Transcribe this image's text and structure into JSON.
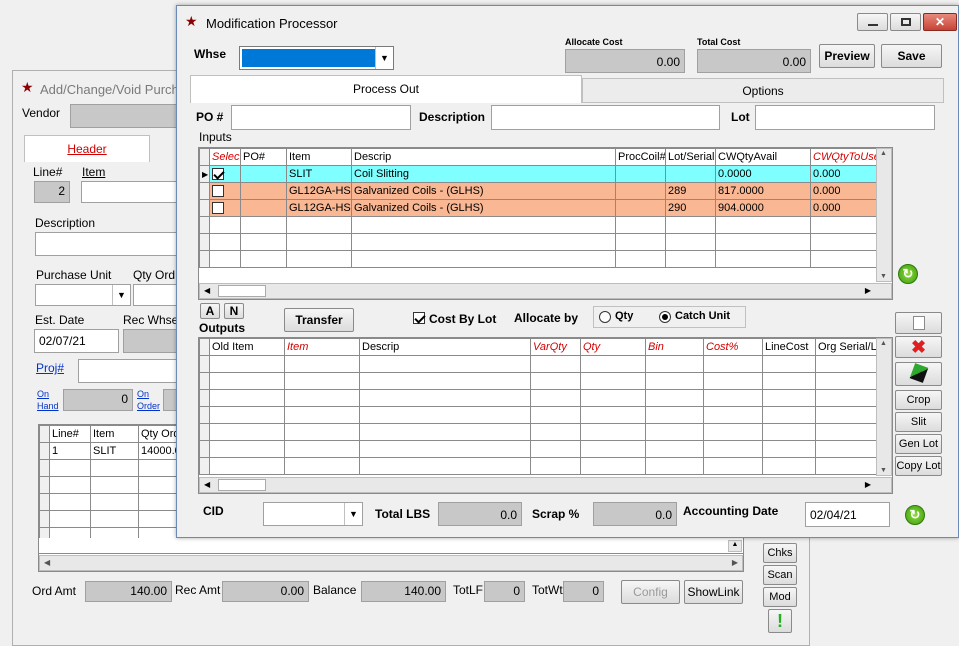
{
  "bg_window": {
    "title": "Add/Change/Void Purcha",
    "vendor_label": "Vendor",
    "header_tab": "Header",
    "line_label": "Line#",
    "line_value": "2",
    "item_label": "Item",
    "description_label": "Description",
    "purchase_unit_label": "Purchase Unit",
    "qty_ord_label": "Qty Ord",
    "est_date_label": "Est. Date",
    "est_date_value": "02/07/21",
    "rec_whse_label": "Rec Whse",
    "proj_label": "Proj#",
    "on_hand_label_1": "On",
    "on_hand_label_2": "Hand",
    "on_hand_value": "0",
    "on_order_label_1": "On",
    "on_order_label_2": "Order",
    "grid_headers": [
      "Line#",
      "Item",
      "Qty Ord"
    ],
    "grid_rows": [
      {
        "line": "1",
        "item": "SLIT",
        "qty": "14000.0"
      }
    ],
    "ord_amt_label": "Ord Amt",
    "ord_amt_value": "140.00",
    "rec_amt_label": "Rec Amt",
    "rec_amt_value": "0.00",
    "balance_label": "Balance",
    "balance_value": "140.00",
    "totlf_label": "TotLF",
    "totlf_value": "0",
    "totwt_label": "TotWt",
    "totwt_value": "0",
    "config_button": "Config",
    "showlink_button": "ShowLink",
    "chks_button": "Chks",
    "scan_button": "Scan",
    "mod_button": "Mod",
    "alert_glyph": "!"
  },
  "mod_window": {
    "title": "Modification Processor",
    "whse_label": "Whse",
    "allocate_cost_label": "Allocate Cost",
    "allocate_cost_value": "0.00",
    "total_cost_label": "Total Cost",
    "total_cost_value": "0.00",
    "preview_button": "Preview",
    "save_button": "Save",
    "tabs": [
      "Process Out",
      "Options"
    ],
    "po_label": "PO #",
    "description_label": "Description",
    "lot_label": "Lot",
    "inputs_label": "Inputs",
    "inputs_headers": [
      "Select",
      "PO#",
      "Item",
      "Descrip",
      "ProcCoil#",
      "Lot/Serial",
      "CWQtyAvail",
      "CWQtyToUse"
    ],
    "inputs_rows": [
      {
        "selected": "true",
        "po": "",
        "item": "SLIT",
        "descrip": "Coil Slitting",
        "proc": "",
        "lot": "",
        "avail": "0.0000",
        "touse": "0.000"
      },
      {
        "selected": "false",
        "po": "",
        "item": "GL12GA-HS",
        "descrip": "Galvanized Coils - (GLHS)",
        "proc": "",
        "lot": "289",
        "avail": "817.0000",
        "touse": "0.000"
      },
      {
        "selected": "false",
        "po": "",
        "item": "GL12GA-HS",
        "descrip": "Galvanized Coils - (GLHS)",
        "proc": "",
        "lot": "290",
        "avail": "904.0000",
        "touse": "0.000"
      }
    ],
    "a_button": "A",
    "n_button": "N",
    "outputs_label": "Outputs",
    "transfer_button": "Transfer",
    "cost_by_lot_label": "Cost By Lot",
    "allocate_by_label": "Allocate by",
    "radio_qty": "Qty",
    "radio_catch_unit": "Catch Unit",
    "outputs_headers": [
      "Old Item",
      "Item",
      "Descrip",
      "VarQty",
      "Qty",
      "Bin",
      "Cost%",
      "LineCost",
      "Org Serial/Lot"
    ],
    "side_buttons": [
      "Crop",
      "Slit",
      "Gen Lot",
      "Copy Lot"
    ],
    "cid_label": "CID",
    "total_lbs_label": "Total LBS",
    "total_lbs_value": "0.0",
    "scrap_label": "Scrap %",
    "scrap_value": "0.0",
    "accounting_date_label": "Accounting Date",
    "accounting_date_value": "02/04/21"
  },
  "colors": {
    "cyan_row": "#7fffff",
    "orange_row": "#f9b793",
    "required_header": "#d40000",
    "selection_blue": "#0078d7"
  }
}
